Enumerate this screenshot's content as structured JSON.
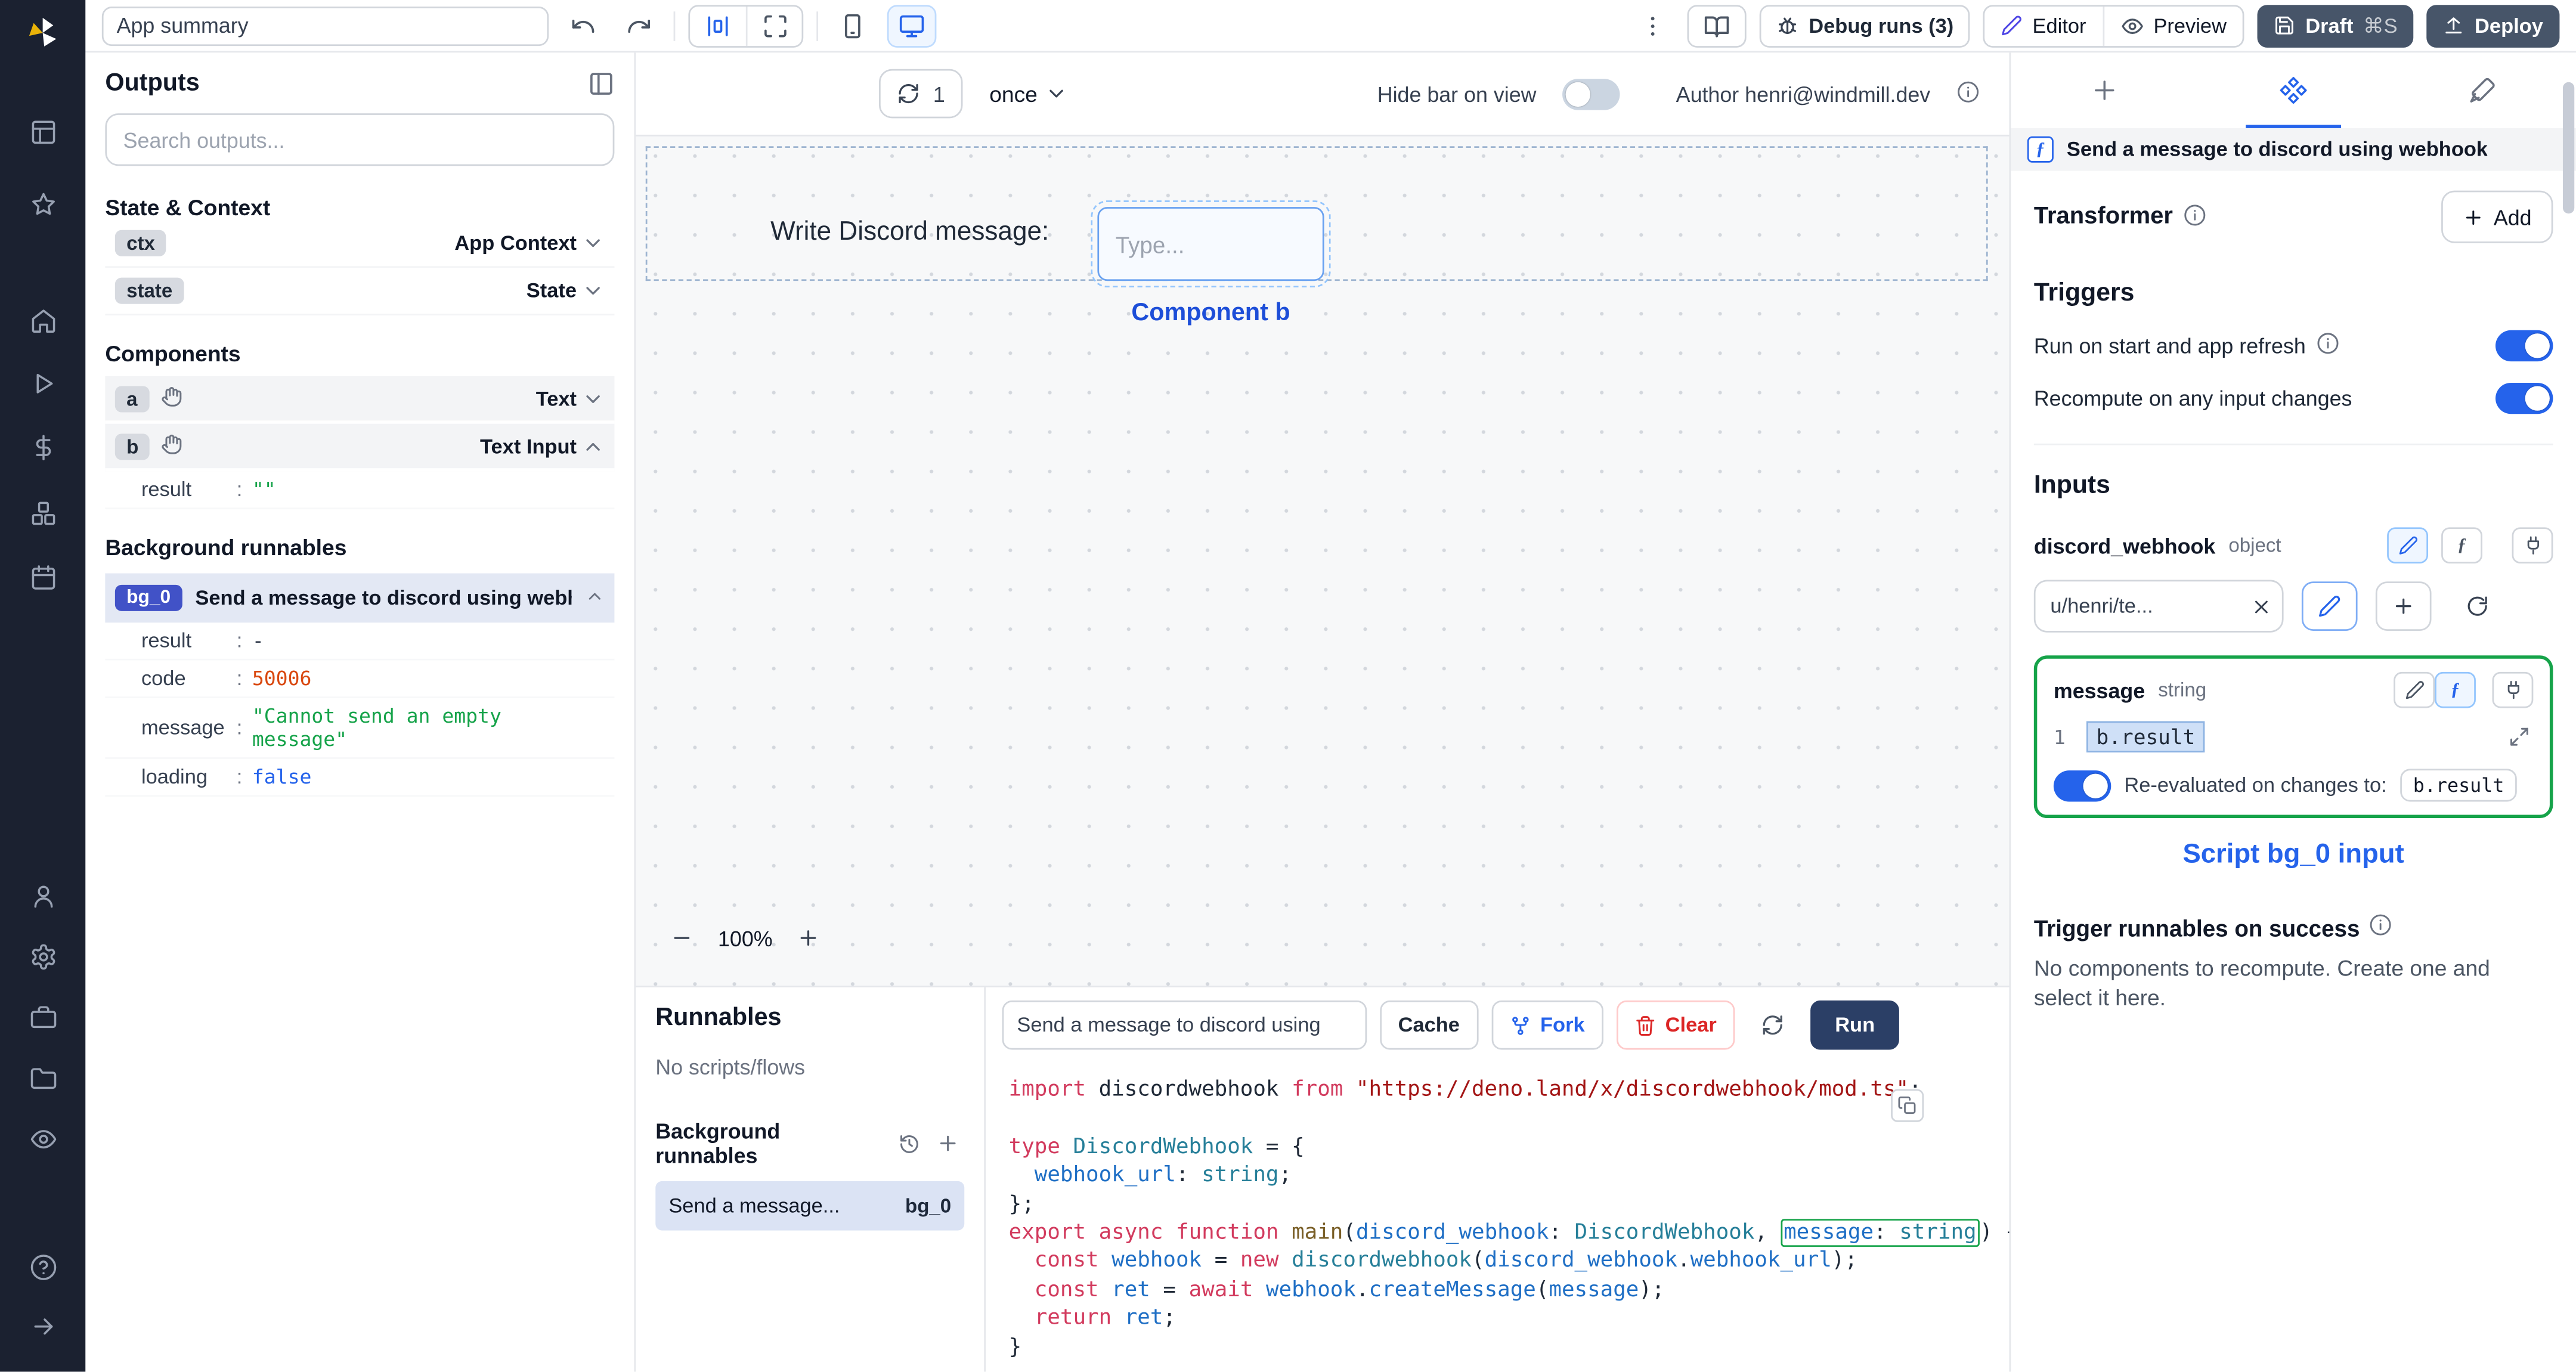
{
  "colors": {
    "accent": "#2563eb",
    "green": "#16a34a",
    "orange": "#d9480f",
    "run_button": "#2b3f66",
    "badge_blue": "#4152c7",
    "danger": "#dc2626",
    "sidebar_bg": "#1b2130"
  },
  "icons": {
    "function_glyph": "ƒ"
  },
  "top_bar": {
    "app_summary": "App summary",
    "debug_runs_label": "Debug runs (3)",
    "editor_label": "Editor",
    "preview_label": "Preview",
    "draft_label": "Draft",
    "draft_shortcut": "⌘S",
    "deploy_label": "Deploy"
  },
  "outputs_panel": {
    "title": "Outputs",
    "search_placeholder": "Search outputs...",
    "separator": ":",
    "state_context_title": "State & Context",
    "ctx": {
      "badge": "ctx",
      "label": "App Context"
    },
    "state": {
      "badge": "state",
      "label": "State"
    },
    "components_title": "Components",
    "component_a": {
      "badge": "a",
      "type": "Text"
    },
    "component_b": {
      "badge": "b",
      "type": "Text Input"
    },
    "component_b_result": {
      "key": "result",
      "value": "\"\""
    },
    "background_title": "Background runnables",
    "bg0": {
      "badge": "bg_0",
      "label": "Send a message to discord using webhook",
      "fields": [
        {
          "key": "result",
          "value": "-"
        },
        {
          "key": "code",
          "value": "50006"
        },
        {
          "key": "message",
          "value": "\"Cannot send an empty message\""
        },
        {
          "key": "loading",
          "value": "false"
        }
      ]
    }
  },
  "canvas": {
    "refresh_count": "1",
    "schedule_mode": "once",
    "hide_bar_label": "Hide bar on view",
    "author_label": "Author henri@windmill.dev",
    "text_component": "Write Discord message:",
    "input_placeholder": "Type...",
    "selection_label": "Component b",
    "zoom_level": "100%"
  },
  "runnables_panel": {
    "title": "Runnables",
    "empty_label": "No scripts/flows",
    "background_title": "Background runnables",
    "item": {
      "label": "Send a message...",
      "badge": "bg_0"
    }
  },
  "script_toolbar": {
    "name_value": "Send a message to discord using",
    "cache_label": "Cache",
    "fork_label": "Fork",
    "clear_label": "Clear",
    "run_label": "Run"
  },
  "code": {
    "lines": [
      [
        {
          "c": "kw",
          "t": "import"
        },
        {
          "c": "pl",
          "t": " discordwebhook "
        },
        {
          "c": "kw",
          "t": "from"
        },
        {
          "c": "pl",
          "t": " "
        },
        {
          "c": "st",
          "t": "\"https://deno.land/x/discordwebhook/mod.ts\""
        },
        {
          "c": "pl",
          "t": ";"
        }
      ],
      [],
      [
        {
          "c": "kw",
          "t": "type"
        },
        {
          "c": "pl",
          "t": " "
        },
        {
          "c": "ty",
          "t": "DiscordWebhook"
        },
        {
          "c": "pl",
          "t": " = {"
        }
      ],
      [
        {
          "c": "pl",
          "t": "  "
        },
        {
          "c": "vr",
          "t": "webhook_url"
        },
        {
          "c": "pl",
          "t": ": "
        },
        {
          "c": "ty",
          "t": "string"
        },
        {
          "c": "pl",
          "t": ";"
        }
      ],
      [
        {
          "c": "pl",
          "t": "};"
        }
      ],
      [
        {
          "c": "kw",
          "t": "export"
        },
        {
          "c": "pl",
          "t": " "
        },
        {
          "c": "kw",
          "t": "async"
        },
        {
          "c": "pl",
          "t": " "
        },
        {
          "c": "kw",
          "t": "function"
        },
        {
          "c": "pl",
          "t": " "
        },
        {
          "c": "fn",
          "t": "main"
        },
        {
          "c": "pl",
          "t": "("
        },
        {
          "c": "vr",
          "t": "discord_webhook"
        },
        {
          "c": "pl",
          "t": ": "
        },
        {
          "c": "ty",
          "t": "DiscordWebhook"
        },
        {
          "c": "pl",
          "t": ", "
        },
        {
          "g": [
            {
              "c": "vr",
              "t": "message"
            },
            {
              "c": "pl",
              "t": ": "
            },
            {
              "c": "ty",
              "t": "string"
            }
          ]
        },
        {
          "c": "pl",
          "t": ") {"
        }
      ],
      [
        {
          "c": "pl",
          "t": "  "
        },
        {
          "c": "kw",
          "t": "const"
        },
        {
          "c": "pl",
          "t": " "
        },
        {
          "c": "vr",
          "t": "webhook"
        },
        {
          "c": "pl",
          "t": " = "
        },
        {
          "c": "kw",
          "t": "new"
        },
        {
          "c": "pl",
          "t": " "
        },
        {
          "c": "ty",
          "t": "discordwebhook"
        },
        {
          "c": "pl",
          "t": "("
        },
        {
          "c": "vr",
          "t": "discord_webhook"
        },
        {
          "c": "pl",
          "t": "."
        },
        {
          "c": "vr",
          "t": "webhook_url"
        },
        {
          "c": "pl",
          "t": ");"
        }
      ],
      [
        {
          "c": "pl",
          "t": "  "
        },
        {
          "c": "kw",
          "t": "const"
        },
        {
          "c": "pl",
          "t": " "
        },
        {
          "c": "vr",
          "t": "ret"
        },
        {
          "c": "pl",
          "t": " = "
        },
        {
          "c": "kw",
          "t": "await"
        },
        {
          "c": "pl",
          "t": " "
        },
        {
          "c": "vr",
          "t": "webhook"
        },
        {
          "c": "pl",
          "t": "."
        },
        {
          "c": "vr",
          "t": "createMessage"
        },
        {
          "c": "pl",
          "t": "("
        },
        {
          "c": "vr",
          "t": "message"
        },
        {
          "c": "pl",
          "t": ");"
        }
      ],
      [
        {
          "c": "pl",
          "t": "  "
        },
        {
          "c": "kw",
          "t": "return"
        },
        {
          "c": "pl",
          "t": " "
        },
        {
          "c": "vr",
          "t": "ret"
        },
        {
          "c": "pl",
          "t": ";"
        }
      ],
      [
        {
          "c": "pl",
          "t": "}"
        }
      ]
    ]
  },
  "settings_panel": {
    "header_title": "Send a message to discord using webhook",
    "transformer_label": "Transformer",
    "add_label": "Add",
    "triggers_title": "Triggers",
    "run_on_start_label": "Run on start and app refresh",
    "recompute_label": "Recompute on any input changes",
    "inputs_title": "Inputs",
    "discord_webhook": {
      "name": "discord_webhook",
      "type": "object",
      "value": "u/henri/te..."
    },
    "message_input": {
      "name": "message",
      "type": "string",
      "line_number": "1",
      "expr": "b.result",
      "reeval_label": "Re-evaluated on changes to:",
      "reeval_target": "b.result"
    },
    "script_input_caption": "Script bg_0 input",
    "trigger_success_title": "Trigger runnables on success",
    "trigger_success_empty": "No components to recompute. Create one and select it here."
  }
}
